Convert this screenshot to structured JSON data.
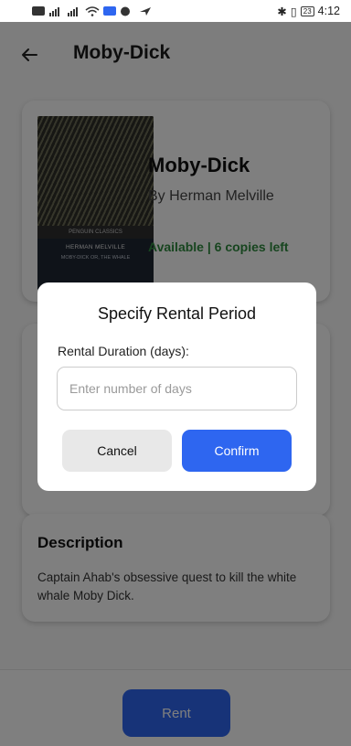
{
  "status_bar": {
    "time": "4:12",
    "battery": "23"
  },
  "header": {
    "title": "Moby-Dick",
    "back_icon": "arrow-left-icon"
  },
  "book": {
    "title": "Moby-Dick",
    "author": "By Herman Melville",
    "availability": "Available | 6 copies left",
    "cover": {
      "series": "PENGUIN CLASSICS",
      "author": "HERMAN MELVILLE",
      "title": "MOBY-DICK OR, THE WHALE"
    }
  },
  "description": {
    "heading": "Description",
    "text": "Captain Ahab's obsessive quest to kill the white whale Moby Dick."
  },
  "footer": {
    "rent_label": "Rent"
  },
  "dialog": {
    "title": "Specify Rental Period",
    "label": "Rental Duration (days):",
    "input_value": "",
    "input_placeholder": "Enter number of days",
    "cancel_label": "Cancel",
    "confirm_label": "Confirm"
  },
  "colors": {
    "primary": "#2e66f0",
    "available": "#2e8b3e",
    "cancel_bg": "#e8e8e8"
  }
}
